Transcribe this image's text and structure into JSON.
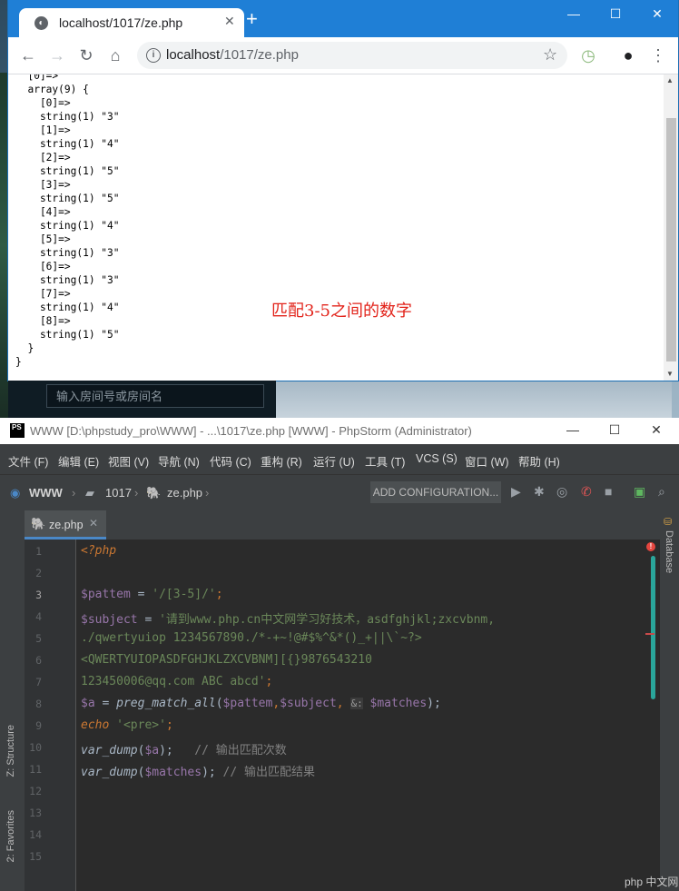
{
  "browser": {
    "tab_title": "localhost/1017/ze.php",
    "tab_close": "✕",
    "new_tab": "+",
    "window_controls": [
      "—",
      "☐",
      "✕"
    ],
    "url_host": "localhost",
    "url_path": "/1017/ze.php",
    "output_lines": [
      "  [0]=>",
      "  array(9) {",
      "    [0]=>",
      "    string(1) \"3\"",
      "    [1]=>",
      "    string(1) \"4\"",
      "    [2]=>",
      "    string(1) \"5\"",
      "    [3]=>",
      "    string(1) \"5\"",
      "    [4]=>",
      "    string(1) \"4\"",
      "    [5]=>",
      "    string(1) \"3\"",
      "    [6]=>",
      "    string(1) \"3\"",
      "    [7]=>",
      "    string(1) \"4\"",
      "    [8]=>",
      "    string(1) \"5\"",
      "  }",
      "}"
    ],
    "annotation": "匹配3-5之间的数字"
  },
  "room_search": {
    "placeholder": "输入房间号或房间名"
  },
  "ide": {
    "title": "WWW [D:\\phpstudy_pro\\WWW] - ...\\1017\\ze.php [WWW] - PhpStorm (Administrator)",
    "logo": "PS",
    "menu": [
      "文件 (F)",
      "编辑 (E)",
      "视图 (V)",
      "导航 (N)",
      "代码 (C)",
      "重构 (R)",
      "运行 (U)",
      "工具 (T)",
      "VCS (S)",
      "窗口 (W)",
      "帮助 (H)"
    ],
    "breadcrumbs": [
      "WWW",
      "1017",
      "ze.php"
    ],
    "add_configuration": "ADD CONFIGURATION...",
    "file_tab": "ze.php",
    "line_numbers": [
      "1",
      "2",
      "3",
      "4",
      "5",
      "6",
      "7",
      "8",
      "9",
      "10",
      "11",
      "12",
      "13",
      "14",
      "15"
    ],
    "code": {
      "l1": "<?php",
      "l3_var": "$pattem",
      "l3_rest": " = ",
      "l3_str": "'/[3-5]/'",
      "l3_end": ";",
      "l4_var": "$subject",
      "l4_eq": " = ",
      "l4_str": "'请到www.php.cn中文网学习好技术，asdfghjkl;zxcvbnm,",
      "l5_str": "./qwertyuiop 1234567890./*-+~!@#$%^&*()_+||\\`~?>",
      "l6_str": "<QWERTYUIOPASDFGHJKLZXCVBNM][{}9876543210",
      "l7_str": "123450006@qq.com ABC abcd'",
      "l7_end": ";",
      "l8_var": "$a",
      "l8_eq": " = ",
      "l8_fn": "preg_match_all",
      "l8_args1": "(",
      "l8_v1": "$pattem",
      "l8_c": ",",
      "l8_v2": "$subject",
      "l8_c2": ", ",
      "l8_amp": "&:",
      "l8_sp": " ",
      "l8_v3": "$matches",
      "l8_end": ");",
      "l9_kw": "echo",
      "l9_str": " '<pre>'",
      "l9_end": ";",
      "l10_fn": "var_dump",
      "l10_a": "(",
      "l10_v": "$a",
      "l10_b": ");",
      "l10_cm": "   // 输出匹配次数",
      "l11_fn": "var_dump",
      "l11_a": "(",
      "l11_v": "$matches",
      "l11_b": ");",
      "l11_cm": " // 输出匹配结果"
    },
    "side_tools": {
      "structure": "Z: Structure",
      "favorites": "2: Favorites",
      "database": "Database"
    }
  },
  "watermark": "php 中文网"
}
